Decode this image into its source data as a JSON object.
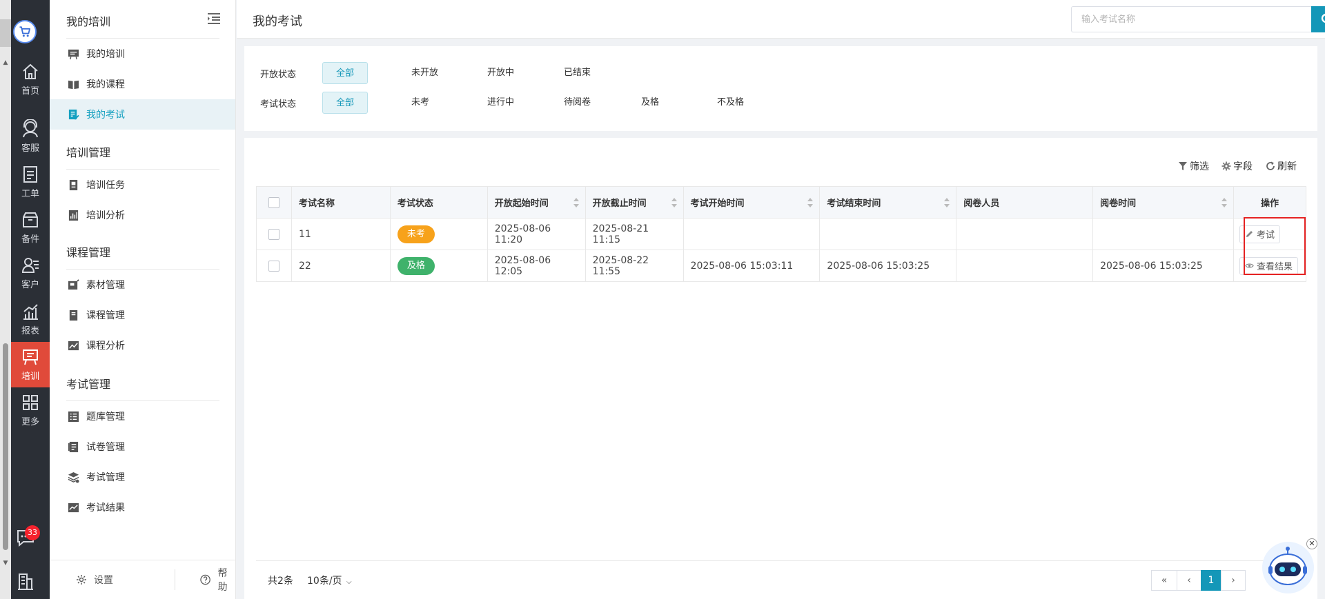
{
  "rail": {
    "items": [
      {
        "label": "首页",
        "icon": "home-icon"
      },
      {
        "label": "客服",
        "icon": "headset-icon"
      },
      {
        "label": "工单",
        "icon": "ticket-icon"
      },
      {
        "label": "备件",
        "icon": "box-icon"
      },
      {
        "label": "客户",
        "icon": "customer-icon"
      },
      {
        "label": "报表",
        "icon": "chart-icon"
      },
      {
        "label": "培训",
        "icon": "training-icon",
        "active": true
      },
      {
        "label": "更多",
        "icon": "grid-icon"
      }
    ],
    "message_badge": "33"
  },
  "sidebar": {
    "title": "我的培训",
    "items_main": [
      "我的培训",
      "我的课程",
      "我的考试"
    ],
    "group_training": "培训管理",
    "items_training": [
      "培训任务",
      "培训分析"
    ],
    "group_course": "课程管理",
    "items_course": [
      "素材管理",
      "课程管理",
      "课程分析"
    ],
    "group_exam": "考试管理",
    "items_exam": [
      "题库管理",
      "试卷管理",
      "考试管理",
      "考试结果"
    ],
    "settings": "设置",
    "help": "帮助"
  },
  "header": {
    "title": "我的考试",
    "search_placeholder": "输入考试名称"
  },
  "filters": {
    "open_label": "开放状态",
    "open_options": [
      "全部",
      "未开放",
      "开放中",
      "已结束"
    ],
    "exam_label": "考试状态",
    "exam_options": [
      "全部",
      "未考",
      "进行中",
      "待阅卷",
      "及格",
      "不及格"
    ]
  },
  "toolbar": {
    "filter": "筛选",
    "fields": "字段",
    "refresh": "刷新"
  },
  "table": {
    "columns": [
      "考试名称",
      "考试状态",
      "开放起始时间",
      "开放截止时间",
      "考试开始时间",
      "考试结束时间",
      "阅卷人员",
      "阅卷时间",
      "操作"
    ],
    "rows": [
      {
        "name": "11",
        "status": "未考",
        "status_color": "#f7a21b",
        "open_start": "2025-08-06 11:20",
        "open_end": "2025-08-21 11:15",
        "exam_start": "",
        "exam_end": "",
        "grader": "",
        "grade_time": "",
        "action": "考试",
        "action_icon": "pencil-icon"
      },
      {
        "name": "22",
        "status": "及格",
        "status_color": "#3fb26b",
        "open_start": "2025-08-06 12:05",
        "open_end": "2025-08-22 11:55",
        "exam_start": "2025-08-06 15:03:11",
        "exam_end": "2025-08-06 15:03:25",
        "grader": "",
        "grade_time": "2025-08-06 15:03:25",
        "action": "查看结果",
        "action_icon": "eye-icon"
      }
    ]
  },
  "pagination": {
    "total": "共2条",
    "page_size": "10条/页",
    "current": "1"
  },
  "colors": {
    "accent": "#1497b8",
    "rail_bg": "#2b2f36",
    "rail_active": "#e04a3a",
    "highlight": "#e52222"
  }
}
